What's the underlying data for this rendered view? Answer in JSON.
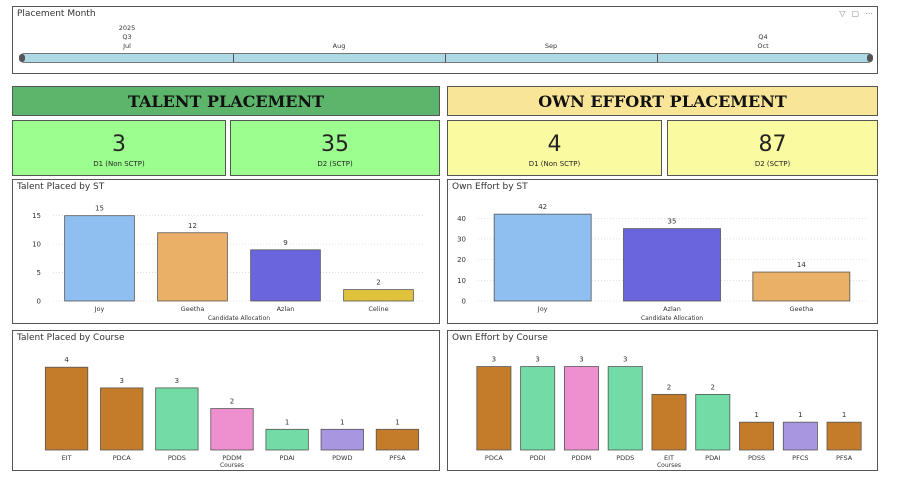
{
  "slicer": {
    "title": "Placement Month",
    "year": "2025",
    "quarters": [
      "Q3",
      "Q4"
    ],
    "months": [
      "Jul",
      "Aug",
      "Sep",
      "Oct"
    ]
  },
  "banners": {
    "talent": "TALENT PLACEMENT",
    "own": "OWN EFFORT PLACEMENT"
  },
  "kpis": {
    "talent_d1": {
      "value": "3",
      "label": "D1 (Non SCTP)"
    },
    "talent_d2": {
      "value": "35",
      "label": "D2 (SCTP)"
    },
    "own_d1": {
      "value": "4",
      "label": "D1 (Non SCTP)"
    },
    "own_d2": {
      "value": "87",
      "label": "D2 (SCTP)"
    }
  },
  "colors": {
    "talent_banner": "#5cb56a",
    "own_banner": "#f9e597",
    "kpi_green": "#9cfe8e",
    "kpi_yellow": "#fafba1"
  },
  "chart_data": [
    {
      "id": "talent-st",
      "title": "Talent Placed by ST",
      "type": "bar",
      "xlabel": "Candidate Allocation",
      "ylabel": "",
      "categories": [
        "Joy",
        "Geetha",
        "Azlan",
        "Celine"
      ],
      "values": [
        15,
        12,
        9,
        2
      ],
      "colors": [
        "#8fbff0",
        "#eab067",
        "#6b65dd",
        "#e1c23c"
      ],
      "yticks": [
        0,
        5,
        10,
        15
      ],
      "ylim": [
        0,
        16
      ],
      "grid": true
    },
    {
      "id": "own-st",
      "title": "Own Effort by ST",
      "type": "bar",
      "xlabel": "Candidate Allocation",
      "ylabel": "",
      "categories": [
        "Joy",
        "Azlan",
        "Geetha"
      ],
      "values": [
        42,
        35,
        14
      ],
      "colors": [
        "#8fbff0",
        "#6b65dd",
        "#eab067"
      ],
      "yticks": [
        0,
        10,
        20,
        30,
        40
      ],
      "ylim": [
        0,
        44
      ],
      "grid": true
    },
    {
      "id": "talent-course",
      "title": "Talent Placed by Course",
      "type": "bar",
      "xlabel": "Courses",
      "ylabel": "",
      "categories": [
        "EIT",
        "PDCA",
        "PDDS",
        "PDDM",
        "PDAI",
        "PDWD",
        "PFSA"
      ],
      "values": [
        4,
        3,
        3,
        2,
        1,
        1,
        1
      ],
      "colors": [
        "#c47b2a",
        "#c47b2a",
        "#72dba6",
        "#ee90cf",
        "#72dba6",
        "#a996e0",
        "#c47b2a"
      ],
      "ylim": [
        0,
        4.3
      ],
      "grid": false
    },
    {
      "id": "own-course",
      "title": "Own Effort by Course",
      "type": "bar",
      "xlabel": "Courses",
      "ylabel": "",
      "categories": [
        "PDCA",
        "PDDI",
        "PDDM",
        "PDDS",
        "EIT",
        "PDAI",
        "PDSS",
        "PFCS",
        "PFSA"
      ],
      "values": [
        3,
        3,
        3,
        3,
        2,
        2,
        1,
        1,
        1
      ],
      "colors": [
        "#c47b2a",
        "#72dba6",
        "#ee90cf",
        "#72dba6",
        "#c47b2a",
        "#72dba6",
        "#c47b2a",
        "#a996e0",
        "#c47b2a"
      ],
      "ylim": [
        0,
        3.2
      ],
      "grid": false
    }
  ]
}
